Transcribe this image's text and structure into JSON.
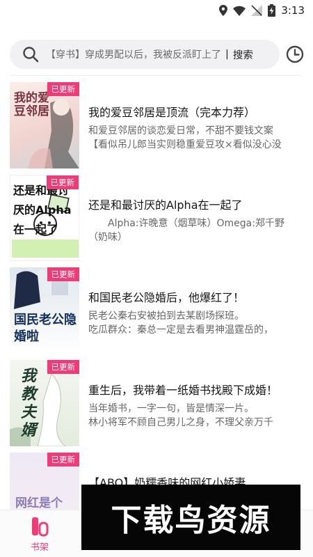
{
  "status": {
    "time": "3:13"
  },
  "search": {
    "placeholder": "【穿书】穿成男配以后，我被反派盯上了",
    "separator": "|",
    "button": "搜索"
  },
  "books": [
    {
      "badge": "已更新",
      "title": "我的爱豆邻居是顶流（完本力荐）",
      "desc1": "和爱豆邻居的谈恋爱日常，不甜不要钱文案",
      "desc2": "【看似吊儿郎当实则稳重爱豆攻×看似没心没",
      "cover_text": "我的爱豆邻居",
      "cover_color": "#f3d9d6"
    },
    {
      "badge": "已更新",
      "title": "还是和最讨厌的Alpha在一起了",
      "desc1": "　　Alpha:许晚意（烟草味）Omega:郑千野",
      "desc2": "（奶味）",
      "cover_text": "还是和最讨厌的Alpha在一起了",
      "cover_color": "#ffffff"
    },
    {
      "badge": "已更新",
      "title": "和国民老公隐婚后，他爆红了！",
      "desc1": "民老公秦右安被拍到去某剧场探班。",
      "desc2": "吃瓜群众：秦总一定是去看男神温霆岳的，",
      "cover_text": "国民老公隐婚啦",
      "cover_color": "#e9eef4"
    },
    {
      "badge": "已更新",
      "title": "重生后，我带着一纸婚书找殿下成婚！",
      "desc1": "当年婚书，一字一句，皆是情深一片。",
      "desc2": "林小将军不顾自己男儿之身，不理父亲万千",
      "cover_text": "我教夫婿",
      "cover_color": "#eef3ec"
    },
    {
      "badge": "已更新",
      "title": "【ABO】奶糯香味的网红小娇妻",
      "desc1": "",
      "desc2": "",
      "cover_text": "网红是个",
      "cover_color": "#eee6f4"
    }
  ],
  "tabbar": {
    "shelf": "书架"
  },
  "watermark": "下载鸟资源",
  "colors": {
    "accent": "#ee3c79"
  }
}
